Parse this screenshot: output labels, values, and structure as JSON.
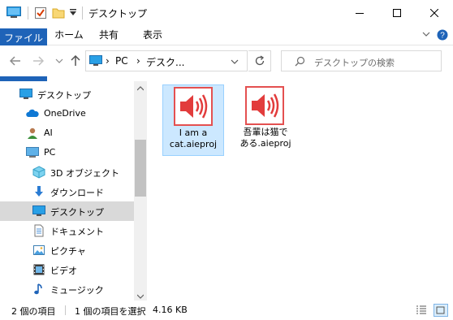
{
  "titlebar": {
    "title": "デスクトップ",
    "controls": [
      "minimize",
      "maximize",
      "close"
    ]
  },
  "ribbon": {
    "tabs": [
      "ファイル",
      "ホーム",
      "共有",
      "表示"
    ],
    "active_tab": "ファイル",
    "accent_color": "#1e63b8"
  },
  "address_bar": {
    "segments": [
      "PC",
      "デスク..."
    ],
    "separator": "›"
  },
  "search": {
    "placeholder": "デスクトップの検索"
  },
  "nav_pane": {
    "items": [
      {
        "label": "デスクトップ",
        "icon": "desktop-icon"
      },
      {
        "label": "OneDrive",
        "icon": "onedrive-icon"
      },
      {
        "label": "AI",
        "icon": "user-icon"
      },
      {
        "label": "PC",
        "icon": "pc-icon"
      },
      {
        "label": "3D オブジェクト",
        "icon": "3d-objects-icon"
      },
      {
        "label": "ダウンロード",
        "icon": "download-icon"
      },
      {
        "label": "デスクトップ",
        "icon": "desktop-icon",
        "selected": true
      },
      {
        "label": "ドキュメント",
        "icon": "documents-icon"
      },
      {
        "label": "ピクチャ",
        "icon": "pictures-icon"
      },
      {
        "label": "ビデオ",
        "icon": "videos-icon"
      },
      {
        "label": "ミュージック",
        "icon": "music-icon"
      }
    ]
  },
  "files": [
    {
      "name_line1": "I am a",
      "name_line2": "cat.aieproj",
      "icon": "speaker-icon",
      "selected": true
    },
    {
      "name_line1": "吾輩は猫で",
      "name_line2": "ある.aieproj",
      "icon": "speaker-icon",
      "selected": false
    }
  ],
  "status": {
    "item_count": "2 個の項目",
    "selected_info": "1 個の項目を選択",
    "size": "4.16 KB"
  }
}
